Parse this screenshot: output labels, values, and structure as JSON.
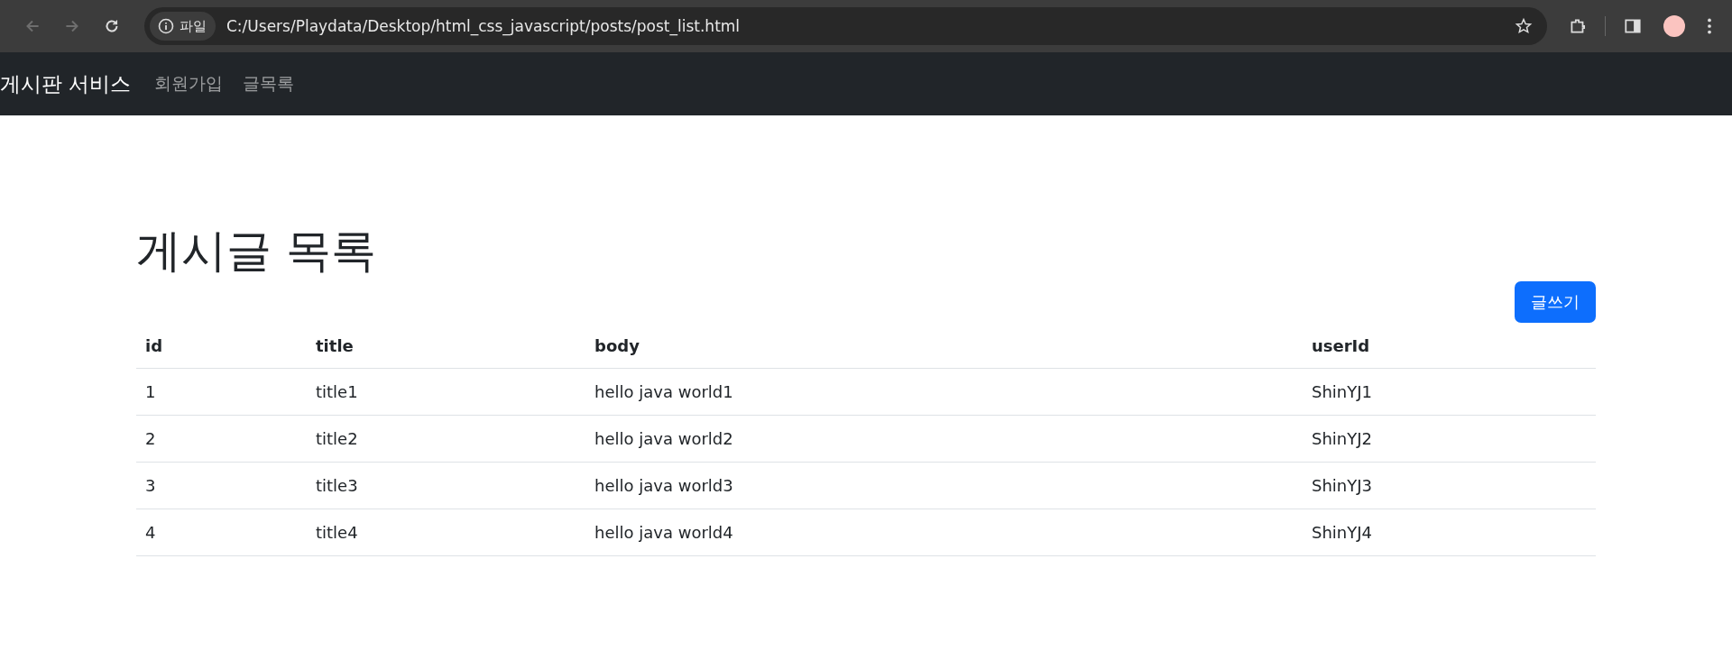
{
  "browser": {
    "site_label": "파일",
    "url": "C:/Users/Playdata/Desktop/html_css_javascript/posts/post_list.html"
  },
  "navbar": {
    "brand": "게시판 서비스",
    "links": [
      "회원가입",
      "글목록"
    ]
  },
  "page": {
    "heading": "게시글 목록",
    "write_button": "글쓰기"
  },
  "table": {
    "columns": [
      "id",
      "title",
      "body",
      "userId"
    ],
    "rows": [
      [
        "1",
        "title1",
        "hello java world1",
        "ShinYJ1"
      ],
      [
        "2",
        "title2",
        "hello java world2",
        "ShinYJ2"
      ],
      [
        "3",
        "title3",
        "hello java world3",
        "ShinYJ3"
      ],
      [
        "4",
        "title4",
        "hello java world4",
        "ShinYJ4"
      ]
    ]
  }
}
